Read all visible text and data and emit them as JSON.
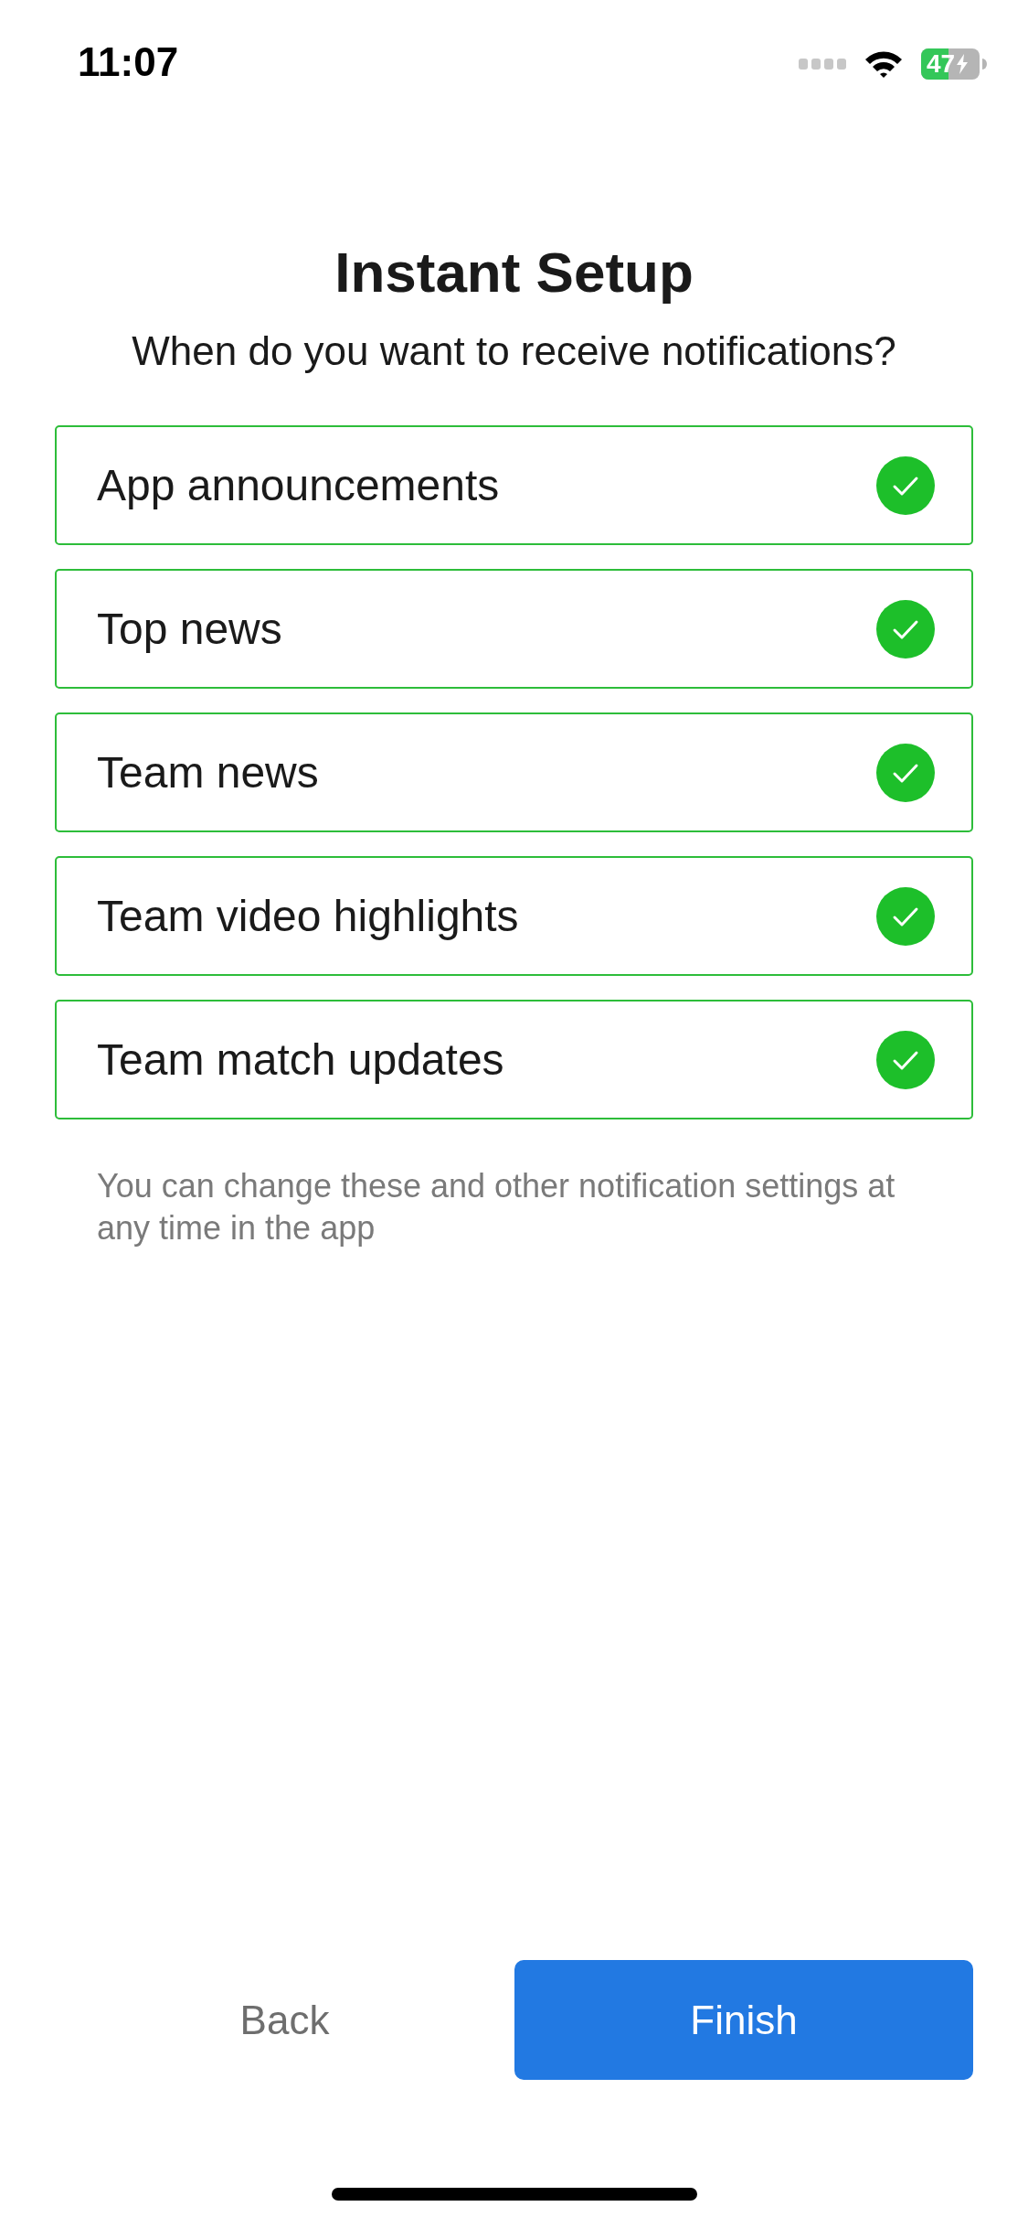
{
  "status_bar": {
    "time": "11:07",
    "battery": "47"
  },
  "title": "Instant Setup",
  "subtitle": "When do you want to receive notifications?",
  "options": [
    {
      "label": "App announcements",
      "checked": true
    },
    {
      "label": "Top news",
      "checked": true
    },
    {
      "label": "Team news",
      "checked": true
    },
    {
      "label": "Team video highlights",
      "checked": true
    },
    {
      "label": "Team match updates",
      "checked": true
    }
  ],
  "note": "You can change these and other notification settings at any time in the app",
  "buttons": {
    "back": "Back",
    "finish": "Finish"
  }
}
